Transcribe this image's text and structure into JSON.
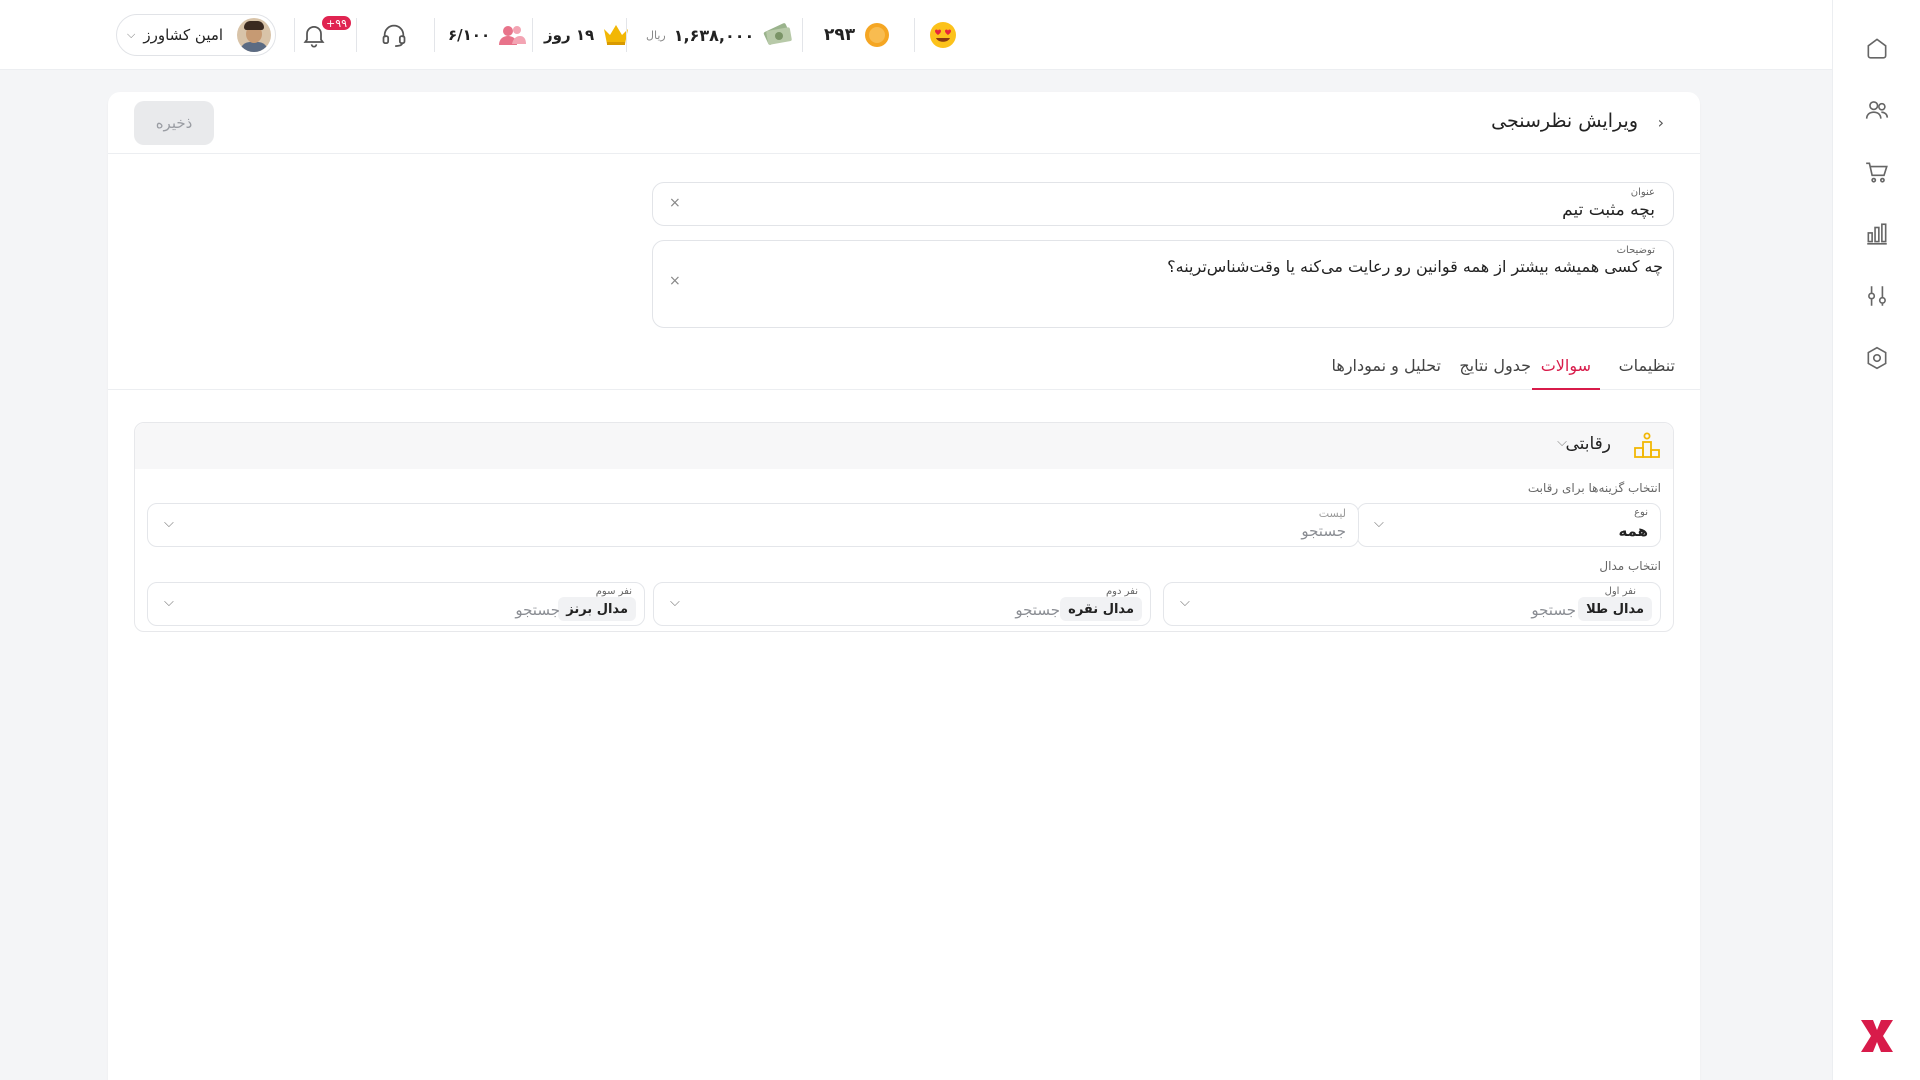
{
  "topbar": {
    "user_name": "امین کشاورز",
    "notification_count": "+۹۹",
    "members": "۶/۱۰۰",
    "subscription_days": "۱۹ روز",
    "balance_value": "۱,۶۳۸,۰۰۰",
    "balance_unit": "ریال",
    "coins": "۲۹۳"
  },
  "page": {
    "title": "ویرایش نظرسنجی",
    "save_label": "ذخیره"
  },
  "form": {
    "title_label": "عنوان",
    "title_value": "بچه مثبت تیم",
    "desc_label": "توضیحات",
    "desc_value": "چه کسی همیشه بیشتر از همه قوانین رو رعایت می‌کنه یا وقت‌شناس‌ترینه؟",
    "clear_symbol": "×"
  },
  "tabs": [
    {
      "label": "تنظیمات",
      "active": false
    },
    {
      "label": "سوالات",
      "active": true
    },
    {
      "label": "جدول نتایج",
      "active": false
    },
    {
      "label": "تحلیل و نمودارها",
      "active": false
    }
  ],
  "section": {
    "title": "رقابتی",
    "options_label": "انتخاب گزینه‌ها برای رقابت",
    "type_label": "نوع",
    "type_value": "همه",
    "list_label": "لیست",
    "list_placeholder": "جستجو",
    "medal_label": "انتخاب مدال",
    "first": {
      "label": "نفر اول",
      "chip": "مدال طلا",
      "placeholder": "جستجو"
    },
    "second": {
      "label": "نفر دوم",
      "chip": "مدال نقره",
      "placeholder": "جستجو"
    },
    "third": {
      "label": "نفر سوم",
      "chip": "مدال برنز",
      "placeholder": "جستجو"
    }
  },
  "colors": {
    "accent": "#d81b4a",
    "gold": "#f2b705",
    "coin": "#f5a623"
  },
  "icons": {
    "sidebar": [
      "home-icon",
      "users-icon",
      "cart-icon",
      "chart-icon",
      "settings-sliders-icon",
      "gear-icon"
    ]
  }
}
